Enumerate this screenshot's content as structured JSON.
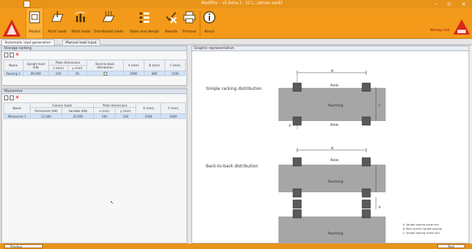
{
  "window": {
    "title": "Mediflor - v5.beta.1 - [C:\\...\\dmon.sarb]",
    "min": "–",
    "max": "▫",
    "close": "×"
  },
  "ribbon": {
    "buttons": [
      {
        "label": "Project",
        "icon": "project-icon"
      },
      {
        "label": "Point loads",
        "icon": "point-loads-icon"
      },
      {
        "label": "Wind loads",
        "icon": "wind-loads-icon"
      },
      {
        "label": "Distributed loads",
        "icon": "distributed-loads-icon"
      },
      {
        "label": "Slabs and design",
        "icon": "slabs-design-icon"
      },
      {
        "label": "Results",
        "icon": "results-icon"
      },
      {
        "label": "Printout",
        "icon": "printer-icon"
      },
      {
        "label": "About",
        "icon": "info-icon"
      }
    ],
    "right_link": "Bitmap link",
    "accent": "#f39a1a",
    "brand_red": "#d7281d"
  },
  "tabs": [
    {
      "label": "Automatic load generation"
    },
    {
      "label": "Manual load input"
    }
  ],
  "storage": {
    "title": "Storage racking",
    "headers": {
      "name": "Name",
      "upright_load": "Upright load (kN)",
      "plate_dims": "Plate dimensions",
      "x": "x (mm)",
      "y": "y (mm)",
      "b2b": "Back-to-back distribution",
      "A": "A (mm)",
      "B": "B (mm)",
      "C": "C (mm)"
    },
    "rows": [
      {
        "name": "Racking 1",
        "upright_load": "80.000",
        "x": "100",
        "y": "50",
        "A": "2000",
        "B": "800",
        "C": "1200"
      }
    ]
  },
  "mezzanine": {
    "title": "Mezzanine",
    "headers": {
      "name": "Name",
      "column_loads": "Column loads",
      "permanent": "Permanent (kN)",
      "variable": "Variable (kN)",
      "plate_dims": "Plate dimensions",
      "x": "x (mm)",
      "y": "y (mm)",
      "X": "X (mm)",
      "Y": "Y (mm)"
    },
    "rows": [
      {
        "name": "Mezzanine 1",
        "permanent": "12.000",
        "variable": "20.000",
        "x": "100",
        "y": "100",
        "X": "2500",
        "Y": "2000"
      }
    ]
  },
  "graphic": {
    "title": "Graphic representation",
    "simple_label": "Simple racking distribution",
    "b2b_label": "Back-to-back distribution",
    "aisle": "Aisle",
    "racking": "Racking",
    "A": "A",
    "B": "B",
    "C": "C",
    "legend": [
      "A: Upright spacing along rack",
      "B: Back-to-back upright spacing",
      "C: Upright spacing across rack"
    ]
  },
  "status": {
    "left_btn": "Previous",
    "right_btn": "Next"
  }
}
